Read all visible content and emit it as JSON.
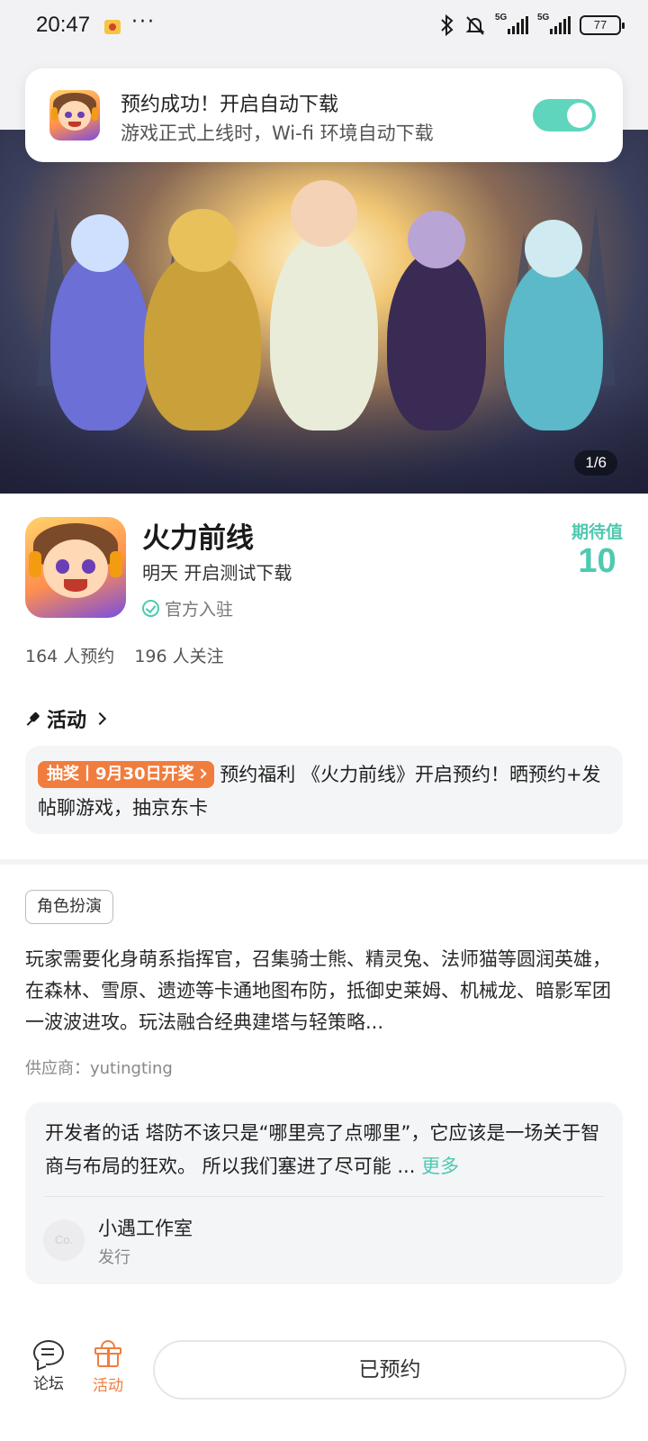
{
  "status_bar": {
    "time": "20:47",
    "more": "···",
    "network_1": "5G",
    "network_2": "5G",
    "battery": "77"
  },
  "toast": {
    "title": "预约成功！开启自动下载",
    "subtitle": "游戏正式上线时，Wi-fi 环境自动下载",
    "toggle_on": true
  },
  "banner": {
    "counter": "1/6"
  },
  "game": {
    "name": "火力前线",
    "status": "明天 开启测试下载",
    "official_label": "官方入驻",
    "expect_label": "期待值",
    "expect_value": "10",
    "reservations": "164 人预约",
    "followers": "196 人关注"
  },
  "activity": {
    "heading": "活动",
    "tag": "抽奖丨9月30日开奖",
    "text": "预约福利 《火力前线》开启预约！晒预约+发帖聊游戏，抽京东卡"
  },
  "details": {
    "genre": "角色扮演",
    "description": "玩家需要化身萌系指挥官，召集骑士熊、精灵兔、法师猫等圆润英雄，在森林、雪原、遗迹等卡通地图布防，抵御史莱姆、机械龙、暗影军团一波波进攻。玩法融合经典建塔与轻策略...",
    "supplier": "供应商：yutingting"
  },
  "developer": {
    "words": "开发者的话  塔防不该只是“哪里亮了点哪里”，它应该是一场关于智商与布局的狂欢。 所以我们塞进了尽可能 ...",
    "more_label": "更多",
    "avatar_text": "Co.",
    "studio": "小遇工作室",
    "role": "发行"
  },
  "bottom_nav": {
    "forum_label": "论坛",
    "activity_label": "活动",
    "reserve_button": "已预约"
  },
  "colors": {
    "accent_teal": "#4fc9b0",
    "accent_orange": "#f07d3d"
  }
}
